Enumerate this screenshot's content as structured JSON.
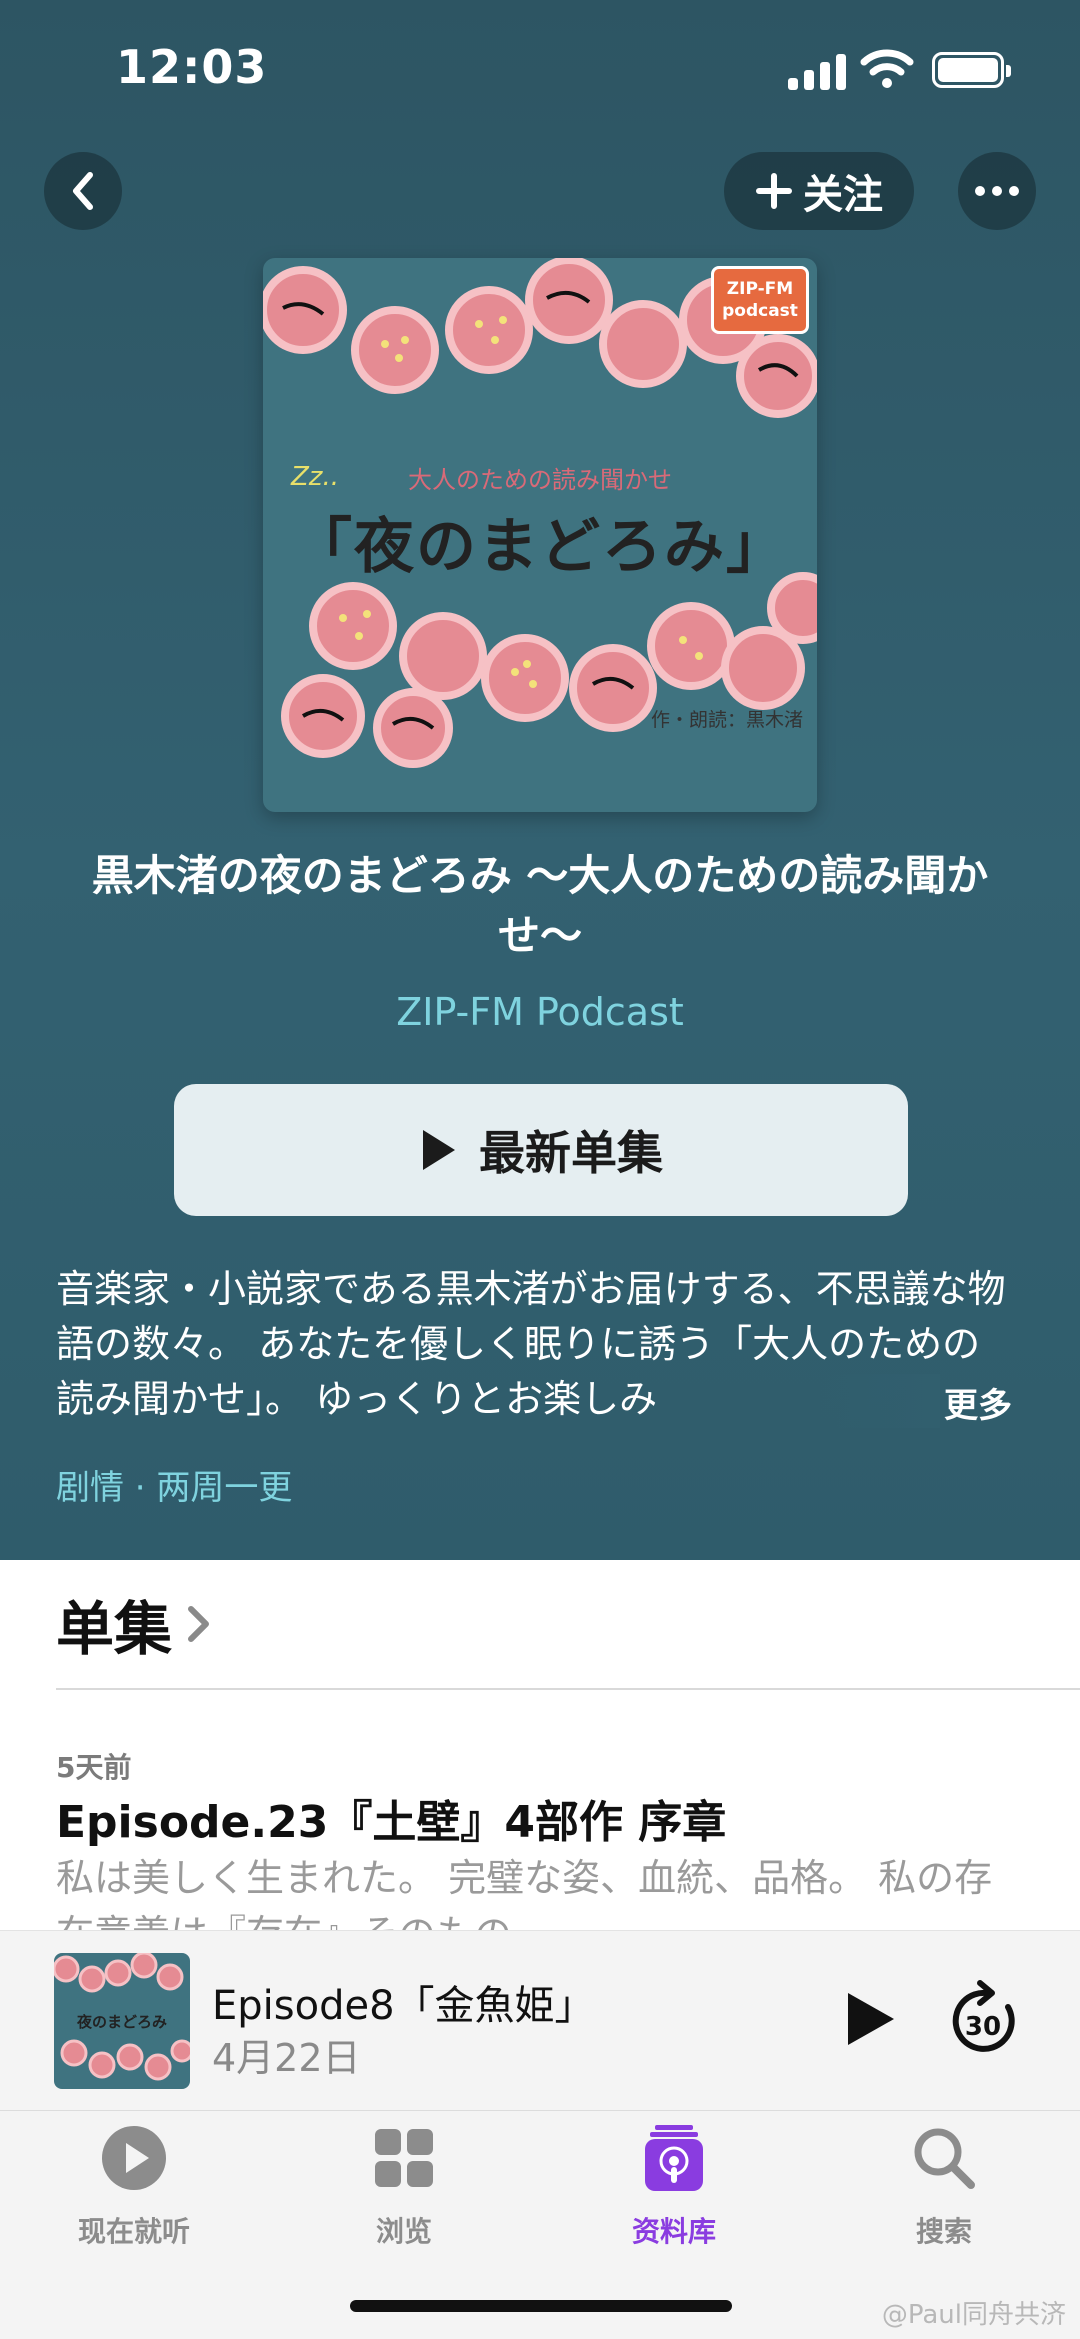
{
  "status": {
    "time": "12:03"
  },
  "header": {
    "follow_label": "关注"
  },
  "artwork": {
    "badge_line1": "ZIP-FM",
    "badge_line2": "podcast",
    "subtitle": "大人のための読み聞かせ",
    "title": "「夜のまどろみ」",
    "zz": "Zz..",
    "credit": "作・朗読：黒木渚"
  },
  "podcast": {
    "title": "黒木渚の夜のまどろみ 〜大人のための読み聞かせ〜",
    "author": "ZIP-FM Podcast",
    "latest_button": "最新单集",
    "description": "音楽家・小説家である黒木渚がお届けする、不思議な物語の数々。 あなたを優しく眠りに誘う「大人のための読み聞かせ」。 ゆっくりとお楽しみ",
    "more_label": "更多",
    "meta": "剧情 · 两周一更"
  },
  "episodes": {
    "section_title": "单集",
    "items": [
      {
        "date": "5天前",
        "title": "Episode.23『土壁』4部作 序章",
        "description": "私は美しく生まれた。 完璧な姿、血統、品格。 私の存在意義は『存在』そのもの"
      }
    ]
  },
  "mini_player": {
    "title": "Episode8「金魚姫」",
    "date": "4月22日",
    "skip_seconds": "30"
  },
  "tabs": [
    {
      "label": "现在就听",
      "icon": "play-circle-icon",
      "active": false
    },
    {
      "label": "浏览",
      "icon": "grid-icon",
      "active": false
    },
    {
      "label": "资料库",
      "icon": "podcast-library-icon",
      "active": true
    },
    {
      "label": "搜索",
      "icon": "search-icon",
      "active": false
    }
  ],
  "watermark": "@Paul同舟共济",
  "colors": {
    "accent": "#8a3ce0",
    "hero": "#336171",
    "link": "#7fd3df"
  }
}
